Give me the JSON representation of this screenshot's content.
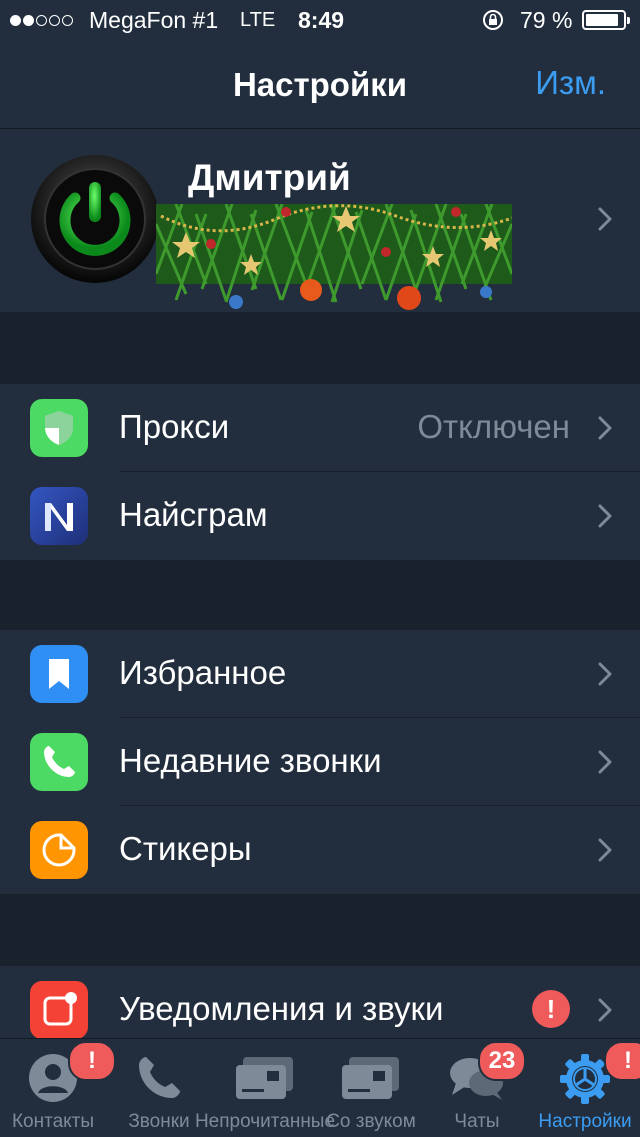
{
  "status_bar": {
    "carrier": "MegaFon #1",
    "network": "LTE",
    "time": "8:49",
    "battery": "79 %",
    "battery_level": 0.79,
    "signal_bars_filled": 2,
    "signal_bars_total": 5
  },
  "nav": {
    "title": "Настройки",
    "edit_label": "Изм."
  },
  "profile": {
    "name": "Дмитрий",
    "avatar_icon": "power-icon"
  },
  "section_proxy": {
    "items": [
      {
        "label": "Прокси",
        "value": "Отключен",
        "icon": "shield-icon",
        "icon_color": "#4cd964"
      },
      {
        "label": "Найсграм",
        "icon": "nicegram-icon",
        "icon_color": "#2e4da8"
      }
    ]
  },
  "section_main": {
    "items": [
      {
        "label": "Избранное",
        "icon": "bookmark-icon",
        "icon_color": "#2f8ff5"
      },
      {
        "label": "Недавние звонки",
        "icon": "phone-icon",
        "icon_color": "#4cd964"
      },
      {
        "label": "Стикеры",
        "icon": "sticker-icon",
        "icon_color": "#ff9500"
      }
    ]
  },
  "section_notifications": {
    "items": [
      {
        "label": "Уведомления и звуки",
        "icon": "notification-icon",
        "icon_color": "#f44336",
        "badge": "!"
      }
    ]
  },
  "tabs": [
    {
      "label": "Контакты",
      "icon": "contacts-icon",
      "badge": "!"
    },
    {
      "label": "Звонки",
      "icon": "phone-icon"
    },
    {
      "label": "Непрочитанные",
      "icon": "cards-icon"
    },
    {
      "label": "Со звуком",
      "icon": "cards-icon"
    },
    {
      "label": "Чаты",
      "icon": "chats-icon",
      "badge": "23"
    },
    {
      "label": "Настройки",
      "icon": "settings-icon",
      "badge": "!",
      "active": true
    }
  ],
  "colors": {
    "background": "#18212c",
    "surface": "#222e3d",
    "accent": "#3b9cf1",
    "secondary_text": "#7d8b99",
    "badge": "#ef5a5a"
  }
}
